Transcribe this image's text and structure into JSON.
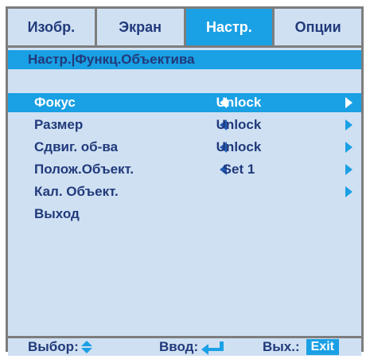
{
  "tabs": [
    {
      "label": "Изобр."
    },
    {
      "label": "Экран"
    },
    {
      "label": "Настр.",
      "active": true
    },
    {
      "label": "Опции"
    }
  ],
  "breadcrumb": "Настр.|Функц.Объектива",
  "menu": [
    {
      "label": "Фокус",
      "value": "Unlock",
      "left_arrow": true,
      "right_arrow": true,
      "selected": true
    },
    {
      "label": "Размер",
      "value": "Unlock",
      "left_arrow": true,
      "right_arrow": true
    },
    {
      "label": "Сдвиг. об-ва",
      "value": "Unlock",
      "left_arrow": true,
      "right_arrow": true
    },
    {
      "label": "Полож.Объект.",
      "value": "Set 1",
      "left_arrow": true,
      "right_arrow": true
    },
    {
      "label": "Кал. Объект.",
      "value": "",
      "left_arrow": false,
      "right_arrow": true
    },
    {
      "label": "Выход",
      "value": "",
      "left_arrow": false,
      "right_arrow": false
    }
  ],
  "footer": {
    "select_label": "Выбор:",
    "enter_label": "Ввод:",
    "exit_label": "Вых.:",
    "exit_key": "Exit"
  },
  "colors": {
    "accent": "#1aa0e4",
    "panel": "#cfe0f3",
    "text": "#213a7a",
    "frame": "#7d7d7d"
  }
}
